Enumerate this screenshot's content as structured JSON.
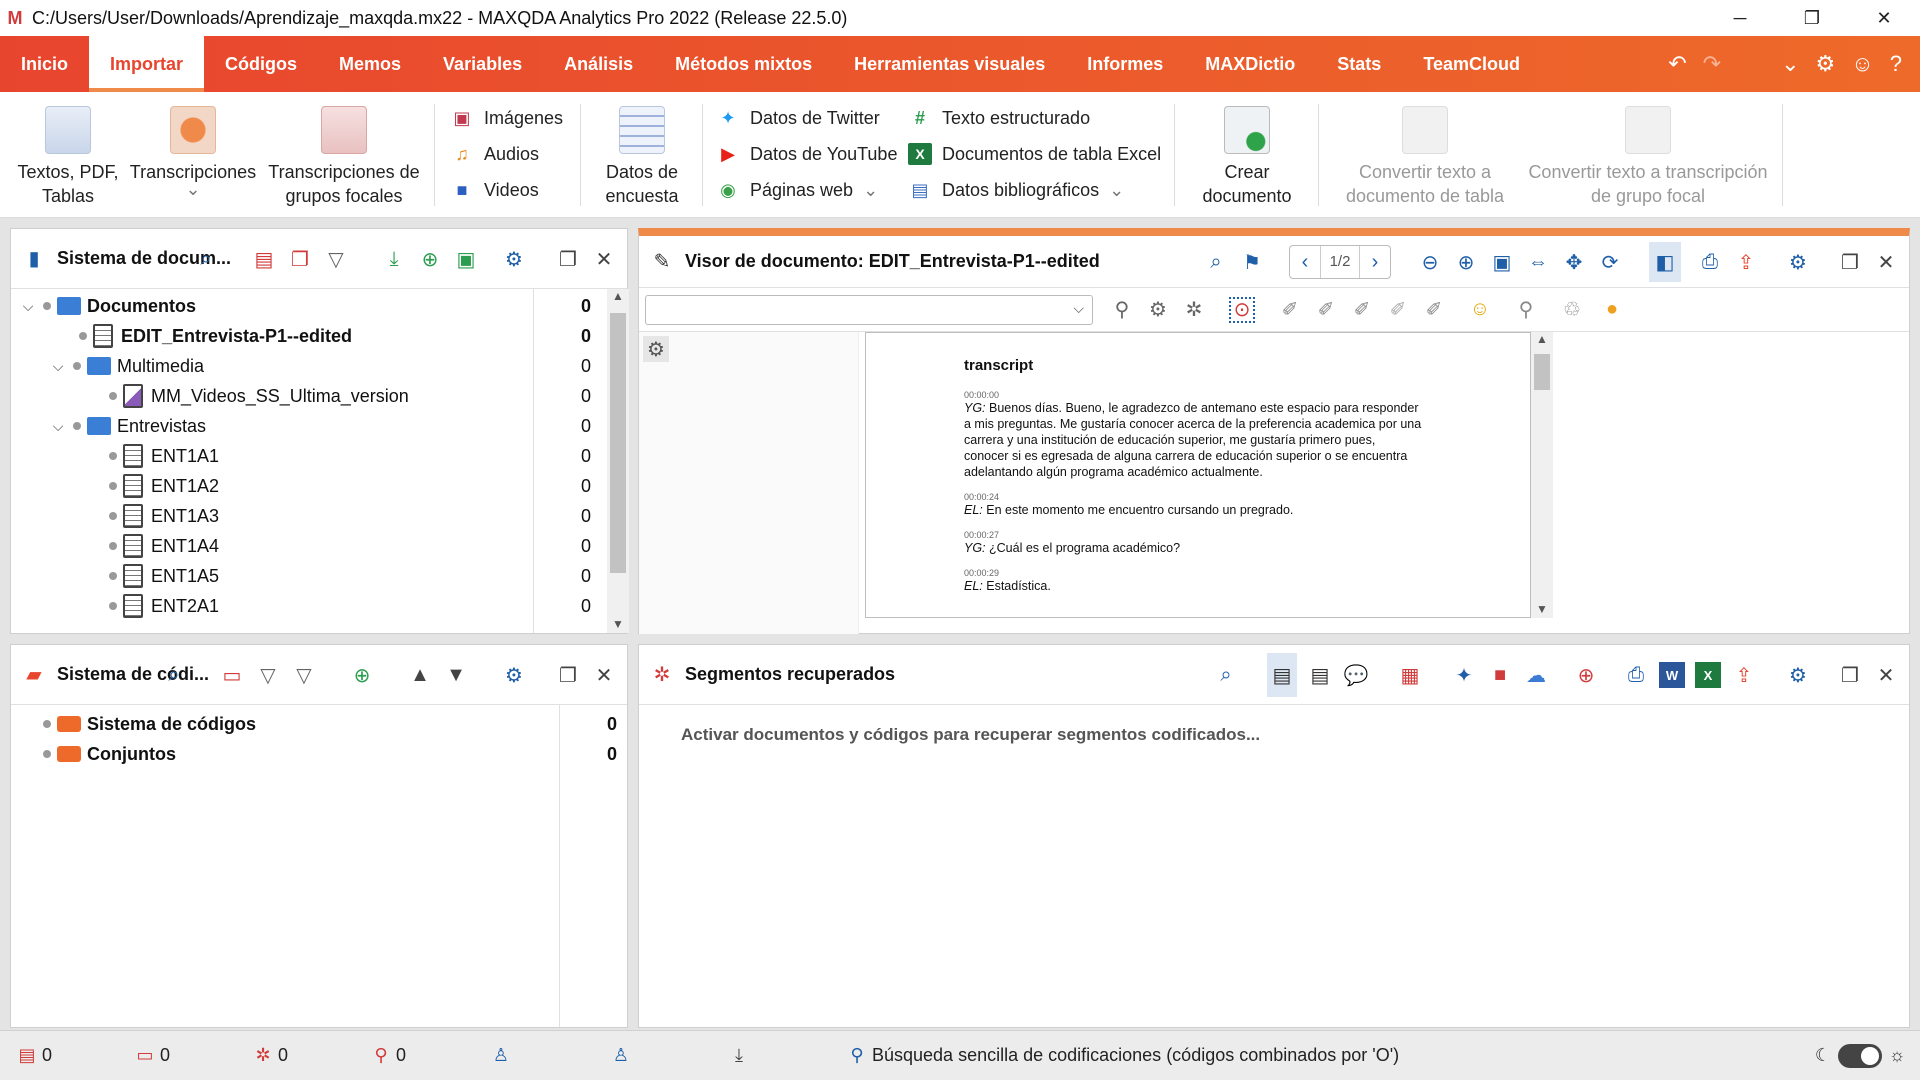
{
  "window": {
    "title": "C:/Users/User/Downloads/Aprendizaje_maxqda.mx22 - MAXQDA Analytics Pro 2022 (Release 22.5.0)",
    "logo": "M"
  },
  "menu": {
    "tabs": [
      {
        "label": "Inicio"
      },
      {
        "label": "Importar"
      },
      {
        "label": "Códigos"
      },
      {
        "label": "Memos"
      },
      {
        "label": "Variables"
      },
      {
        "label": "Análisis"
      },
      {
        "label": "Métodos mixtos"
      },
      {
        "label": "Herramientas visuales"
      },
      {
        "label": "Informes"
      },
      {
        "label": "MAXDictio"
      },
      {
        "label": "Stats"
      },
      {
        "label": "TeamCloud"
      }
    ],
    "active": "Importar"
  },
  "ribbon": {
    "textos_line1": "Textos, PDF,",
    "textos_line2": "Tablas",
    "transcripciones": "Transcripciones",
    "grupos_line1": "Transcripciones de",
    "grupos_line2": "grupos focales",
    "imagenes": "Imágenes",
    "audios": "Audios",
    "videos": "Videos",
    "encuesta_line1": "Datos de",
    "encuesta_line2": "encuesta",
    "twitter": "Datos de Twitter",
    "youtube": "Datos de YouTube",
    "paginas_web": "Páginas web",
    "texto_estructurado": "Texto estructurado",
    "excel": "Documentos de tabla Excel",
    "bibliograficos": "Datos bibliográficos",
    "crear_line1": "Crear",
    "crear_line2": "documento",
    "convertir_tabla_line1": "Convertir texto a",
    "convertir_tabla_line2": "documento de tabla",
    "convertir_grupo_line1": "Convertir texto a transcripción",
    "convertir_grupo_line2": "de grupo focal",
    "chevron": "⌄"
  },
  "doc_system": {
    "title": "Sistema de docum...",
    "rows": [
      {
        "label": "Documentos",
        "count": "0"
      },
      {
        "label": "EDIT_Entrevista-P1--edited",
        "count": "0"
      },
      {
        "label": "Multimedia",
        "count": "0"
      },
      {
        "label": "MM_Videos_SS_Ultima_version",
        "count": "0"
      },
      {
        "label": "Entrevistas",
        "count": "0"
      },
      {
        "label": "ENT1A1",
        "count": "0"
      },
      {
        "label": "ENT1A2",
        "count": "0"
      },
      {
        "label": "ENT1A3",
        "count": "0"
      },
      {
        "label": "ENT1A4",
        "count": "0"
      },
      {
        "label": "ENT1A5",
        "count": "0"
      },
      {
        "label": "ENT2A1",
        "count": "0"
      }
    ]
  },
  "viewer": {
    "title": "Visor de documento: EDIT_Entrevista-P1--edited",
    "page": "1/2",
    "heading": "transcript",
    "entries": [
      {
        "ts": "00:00:00",
        "speaker": "YG:",
        "text": " Buenos días. Bueno, le agradezco de antemano este espacio para responder a mis preguntas. Me gustaría conocer acerca de la preferencia academica por una carrera y una institución de educación superior, me gustaría primero pues, conocer si es egresada de alguna carrera de educación superior o se encuentra adelantando algún programa académico actualmente."
      },
      {
        "ts": "00:00:24",
        "speaker": "EL:",
        "text": " En este momento me encuentro cursando un pregrado."
      },
      {
        "ts": "00:00:27",
        "speaker": "YG:",
        "text": " ¿Cuál es el programa académico?"
      },
      {
        "ts": "00:00:29",
        "speaker": "EL:",
        "text": " Estadística."
      }
    ]
  },
  "code_system": {
    "title": "Sistema de códi...",
    "rows": [
      {
        "label": "Sistema de códigos",
        "count": "0"
      },
      {
        "label": "Conjuntos",
        "count": "0"
      }
    ]
  },
  "segments": {
    "title": "Segmentos recuperados",
    "message": "Activar documentos y códigos para recuperar segmentos codificados..."
  },
  "status": {
    "docs": "0",
    "codes": "0",
    "segments": "0",
    "memos": "0",
    "mode_text": "Búsqueda sencilla de codificaciones (códigos combinados por 'O')"
  },
  "colors": {
    "accent": "#e8452e",
    "accent2": "#ee6a2a",
    "blue": "#1f5fa8",
    "viewer_top": "#f08a4b"
  }
}
